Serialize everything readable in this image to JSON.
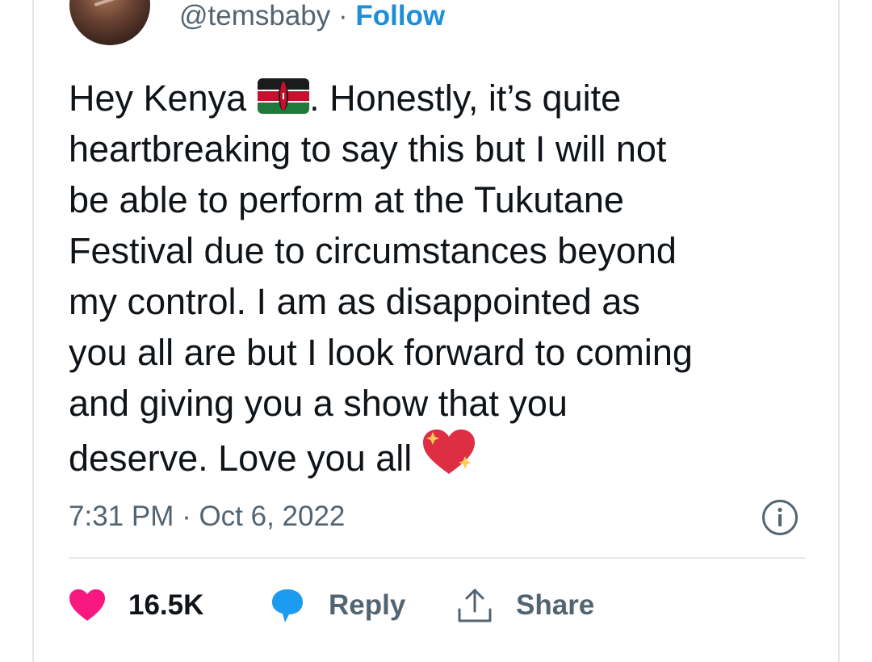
{
  "author": {
    "handle": "@temsbaby",
    "separator": "·",
    "follow_label": "Follow"
  },
  "tweet": {
    "lines": [
      "Hey Kenya",
      ". Honestly, it’s quite",
      "heartbreaking to say this but I will not",
      "be able to perform at the Tukutane",
      "Festival due to circumstances beyond",
      "my control. I am as disappointed as",
      "you all are but I look forward to coming",
      "and giving you a show that you",
      "deserve. Love you all"
    ],
    "emojis": [
      "kenya-flag-emoji",
      "sparkling-heart-emoji"
    ],
    "timestamp": "7:31 PM · Oct 6, 2022"
  },
  "actions": {
    "like_count": "16.5K",
    "reply_label": "Reply",
    "share_label": "Share"
  },
  "colors": {
    "text": "#0f1419",
    "secondary": "#536471",
    "follow": "#1d8fd8",
    "like": "#f91880",
    "reply": "#1d9bf0",
    "divider": "#e3e8ec"
  },
  "icons": [
    "info-icon",
    "heart-icon",
    "reply-bubble-icon",
    "share-icon"
  ]
}
